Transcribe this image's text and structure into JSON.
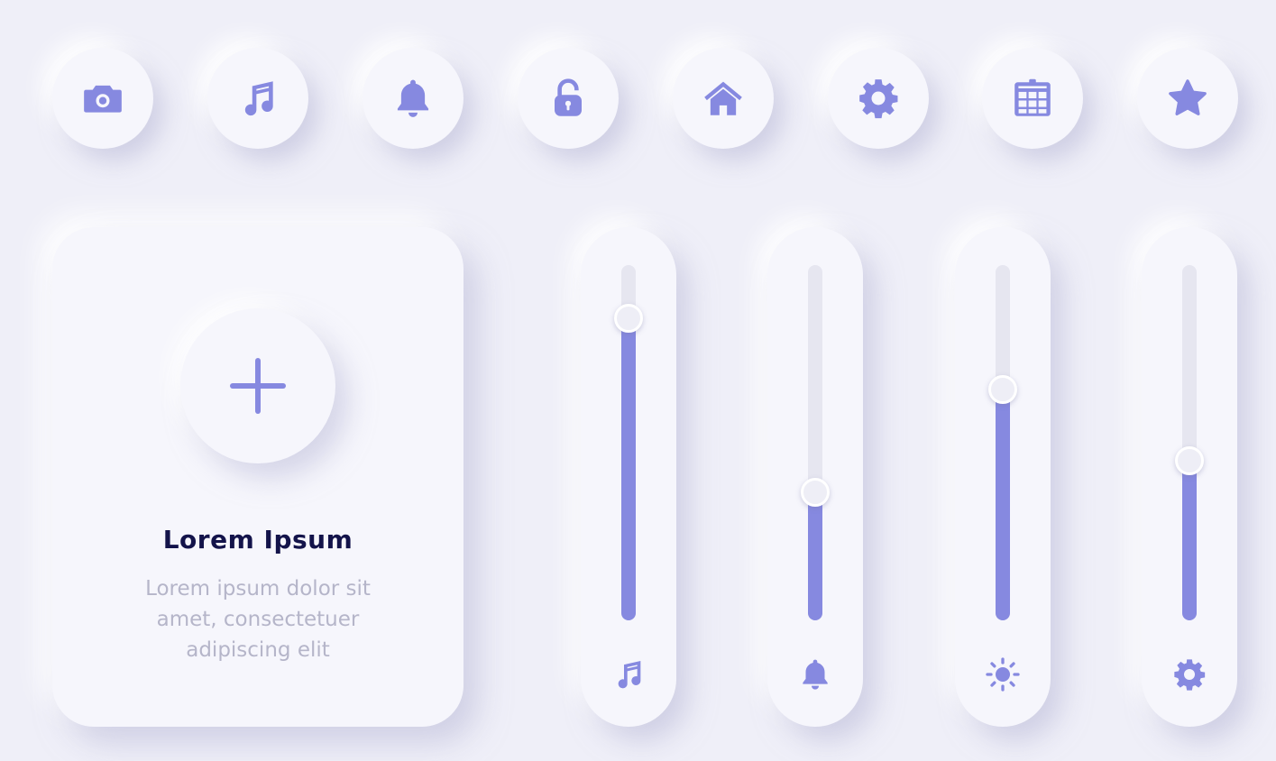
{
  "accent_color": "#8689e0",
  "background_color": "#efeff8",
  "top_icons": [
    {
      "icon": "camera-icon"
    },
    {
      "icon": "music-note-icon"
    },
    {
      "icon": "bell-icon"
    },
    {
      "icon": "unlock-icon"
    },
    {
      "icon": "home-icon"
    },
    {
      "icon": "gear-icon"
    },
    {
      "icon": "calendar-icon"
    },
    {
      "icon": "star-icon"
    }
  ],
  "card": {
    "add_icon": "plus-icon",
    "title": "Lorem Ipsum",
    "description": "Lorem ipsum dolor sit amet, consectetuer adipiscing elit"
  },
  "sliders": [
    {
      "icon": "music-note-icon",
      "level_percent": 85
    },
    {
      "icon": "bell-icon",
      "level_percent": 36
    },
    {
      "icon": "sun-icon",
      "level_percent": 65
    },
    {
      "icon": "gear-icon",
      "level_percent": 45
    }
  ]
}
